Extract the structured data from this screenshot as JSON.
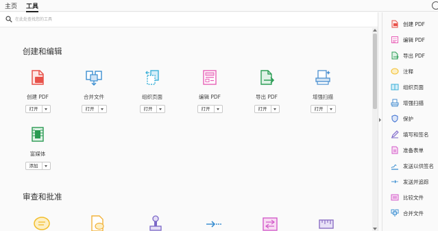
{
  "tabs": [
    {
      "label": "主页",
      "active": false
    },
    {
      "label": "工具",
      "active": true
    }
  ],
  "search": {
    "placeholder": "在此处查找您的工具"
  },
  "sections": [
    {
      "title": "创建和编辑"
    },
    {
      "title": "审查和批准"
    }
  ],
  "tools": [
    {
      "label": "创建 PDF",
      "action": "打开",
      "icon": "create-pdf-icon",
      "color": "#e8524a"
    },
    {
      "label": "合并文件",
      "action": "打开",
      "icon": "combine-files-icon",
      "color": "#3c8fd1"
    },
    {
      "label": "组织页面",
      "action": "打开",
      "icon": "organize-pages-icon",
      "color": "#3bb0d8"
    },
    {
      "label": "编辑 PDF",
      "action": "打开",
      "icon": "edit-pdf-icon",
      "color": "#e75fb6"
    },
    {
      "label": "导出 PDF",
      "action": "打开",
      "icon": "export-pdf-icon",
      "color": "#2e9e57"
    },
    {
      "label": "增强扫描",
      "action": "打开",
      "icon": "enhance-scan-icon",
      "color": "#4a8fd0"
    },
    {
      "label": "富媒体",
      "action": "添加",
      "icon": "rich-media-icon",
      "color": "#2a9a52"
    }
  ],
  "review_tools": [
    {
      "icon": "comment-icon",
      "color": "#f2bd2a"
    },
    {
      "icon": "send-for-comments-icon",
      "color": "#f2b23a"
    },
    {
      "icon": "stamp-icon",
      "color": "#7b67c7"
    },
    {
      "icon": "send-and-track-icon",
      "color": "#3c8fd1"
    },
    {
      "icon": "compare-files-icon",
      "color": "#d25bc9"
    },
    {
      "icon": "measure-icon",
      "color": "#8a6fc4"
    }
  ],
  "right_panel": [
    {
      "label": "创建 PDF",
      "icon": "create-pdf-icon",
      "color": "#e8524a"
    },
    {
      "label": "编辑 PDF",
      "icon": "edit-pdf-icon",
      "color": "#e75fb6"
    },
    {
      "label": "导出 PDF",
      "icon": "export-pdf-icon",
      "color": "#2e9e57"
    },
    {
      "label": "注释",
      "icon": "comment-icon",
      "color": "#f2bd2a"
    },
    {
      "label": "组织页面",
      "icon": "organize-pages-icon",
      "color": "#3bb0d8"
    },
    {
      "label": "增强扫描",
      "icon": "enhance-scan-icon",
      "color": "#4a8fd0"
    },
    {
      "label": "保护",
      "icon": "protect-icon",
      "color": "#3c6fd1"
    },
    {
      "label": "填写和签名",
      "icon": "fill-sign-icon",
      "color": "#7b67c7"
    },
    {
      "label": "准备表单",
      "icon": "prepare-form-icon",
      "color": "#d25bc9"
    },
    {
      "label": "发送以供签名",
      "icon": "send-for-signature-icon",
      "color": "#3c8fd1"
    },
    {
      "label": "发送并追踪",
      "icon": "send-and-track-icon",
      "color": "#3c8fd1"
    },
    {
      "label": "比较文件",
      "icon": "compare-files-icon",
      "color": "#d25bc9"
    },
    {
      "label": "合并文件",
      "icon": "combine-files-icon",
      "color": "#3c8fd1"
    }
  ]
}
